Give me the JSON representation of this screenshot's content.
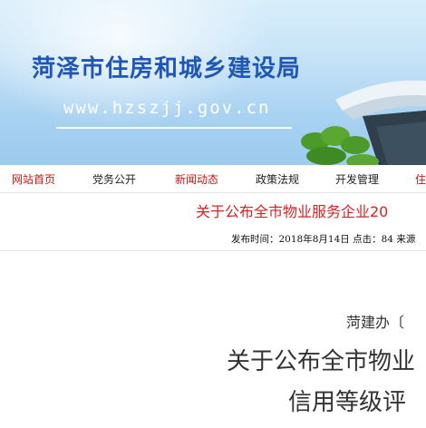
{
  "banner": {
    "title": "菏泽市住房和城乡建设局",
    "url": "www.hzszjj.gov.cn"
  },
  "nav": {
    "items": [
      {
        "label": "网站首页"
      },
      {
        "label": "党务公开"
      },
      {
        "label": "新闻动态"
      },
      {
        "label": "政策法规"
      },
      {
        "label": "开发管理"
      },
      {
        "label": "住"
      }
    ]
  },
  "article": {
    "headline": "关于公布全市物业服务企业20",
    "meta": {
      "publish_label": "发布时间：",
      "publish_date": "2018年8月14日",
      "clicks_label": "点击：",
      "clicks": "84",
      "source_label": "来源"
    }
  },
  "document": {
    "doc_number": "菏建办〔",
    "title_line1": "关于公布全市物业",
    "title_line2": "信用等级评"
  },
  "colors": {
    "title_blue": "#1f56b8",
    "nav_red": "#c81414",
    "headline_red": "#d62222"
  }
}
